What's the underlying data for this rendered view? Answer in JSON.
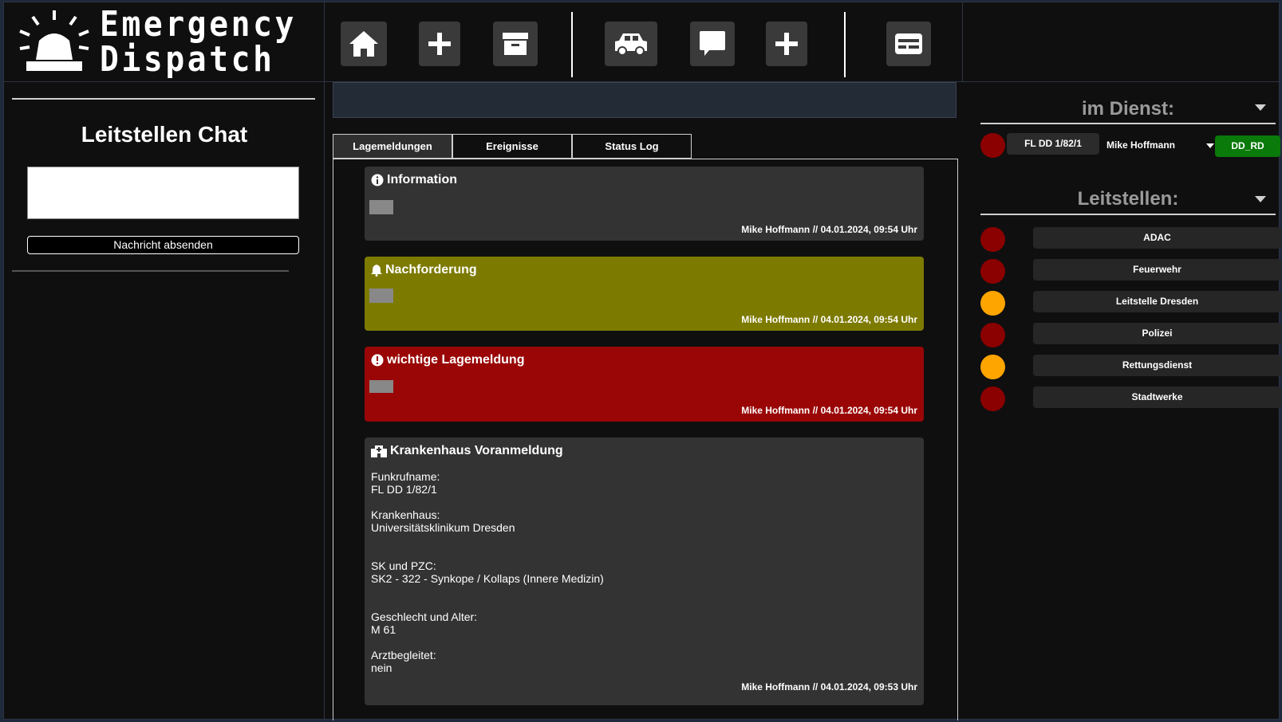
{
  "app": {
    "logo_line1": "Emergency",
    "logo_line2": "Dispatch"
  },
  "toolbar": {
    "buttons": [
      {
        "icon": "home-icon"
      },
      {
        "icon": "plus-icon"
      },
      {
        "icon": "archive-icon"
      },
      {
        "icon": "car-icon"
      },
      {
        "icon": "chat-bubble-icon"
      },
      {
        "icon": "plus-icon"
      },
      {
        "icon": "card-icon"
      }
    ]
  },
  "chat": {
    "title": "Leitstellen Chat",
    "input_value": "",
    "send_label": "Nachricht absenden"
  },
  "center": {
    "tabs": [
      {
        "label": "Lagemeldungen",
        "active": true
      },
      {
        "label": "Ereignisse",
        "active": false
      },
      {
        "label": "Status Log",
        "active": false
      }
    ],
    "cards": [
      {
        "type": "information",
        "icon": "info-circle-icon",
        "title": "Information",
        "footer": "Mike Hoffmann // 04.01.2024, 09:54 Uhr",
        "bg": "#333333"
      },
      {
        "type": "nachforderung",
        "icon": "bell-icon",
        "title": "Nachforderung",
        "footer": "Mike Hoffmann // 04.01.2024, 09:54 Uhr",
        "bg": "#7d7a00"
      },
      {
        "type": "wichtig",
        "icon": "exclamation-circle-icon",
        "title": "wichtige Lagemeldung",
        "footer": "Mike Hoffmann // 04.01.2024, 09:54 Uhr",
        "bg": "#9a0606"
      },
      {
        "type": "krankenhaus",
        "icon": "hospital-icon",
        "title": "Krankenhaus Voranmeldung",
        "fields": [
          {
            "label": "Funkrufname:",
            "value": "FL DD 1/82/1"
          },
          {
            "label": "Krankenhaus:",
            "value": "Universitätsklinikum Dresden"
          },
          {
            "label": "SK und PZC:",
            "value": "SK2 - 322 - Synkope / Kollaps (Innere Medizin)"
          },
          {
            "label": "Geschlecht und Alter:",
            "value": "M 61"
          },
          {
            "label": "Arztbegleitet:",
            "value": "nein"
          }
        ],
        "footer": "Mike Hoffmann // 04.01.2024, 09:53 Uhr",
        "bg": "#333333"
      }
    ]
  },
  "right": {
    "on_duty_title": "im Dienst:",
    "unit": {
      "call_sign": "FL DD 1/82/1",
      "person": "Mike Hoffmann",
      "org": "DD_RD",
      "status_color": "#8b0000",
      "org_color": "#0a7a0a"
    },
    "dispatch_title": "Leitstellen:",
    "dispatch_centers": [
      {
        "name": "ADAC",
        "status_color": "#8b0000"
      },
      {
        "name": "Feuerwehr",
        "status_color": "#8b0000"
      },
      {
        "name": "Leitstelle Dresden",
        "status_color": "#ffa500"
      },
      {
        "name": "Polizei",
        "status_color": "#8b0000"
      },
      {
        "name": "Rettungsdienst",
        "status_color": "#ffa500"
      },
      {
        "name": "Stadtwerke",
        "status_color": "#8b0000"
      }
    ]
  }
}
